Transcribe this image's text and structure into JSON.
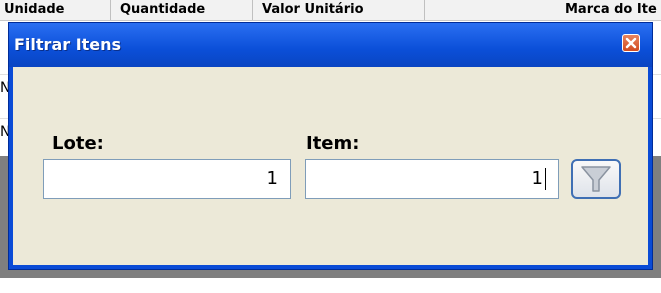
{
  "background": {
    "columns": [
      "Unidade",
      "Quantidade",
      "Valor Unitário",
      "Marca do Ite"
    ],
    "row_markers": [
      "N",
      "N"
    ]
  },
  "dialog": {
    "title": "Filtrar Itens",
    "close_icon": "close-icon",
    "lote": {
      "label": "Lote:",
      "value": "1"
    },
    "item": {
      "label": "Item:",
      "value": "1"
    },
    "filter_button_icon": "filter-icon"
  }
}
